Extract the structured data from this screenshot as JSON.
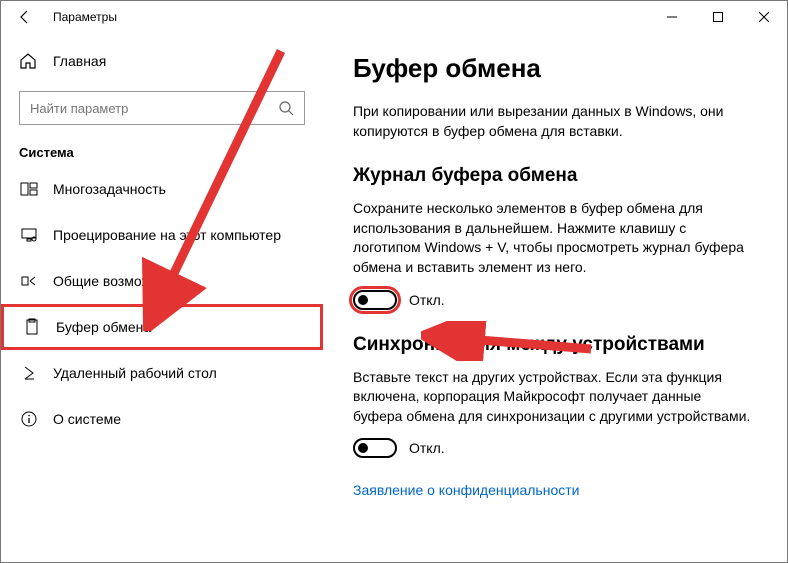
{
  "window": {
    "title": "Параметры"
  },
  "sidebar": {
    "home": "Главная",
    "search_placeholder": "Найти параметр",
    "group": "Система",
    "items": [
      {
        "label": "Многозадачность"
      },
      {
        "label": "Проецирование на этот компьютер"
      },
      {
        "label": "Общие возможности"
      },
      {
        "label": "Буфер обмена"
      },
      {
        "label": "Удаленный рабочий стол"
      },
      {
        "label": "О системе"
      }
    ]
  },
  "content": {
    "title": "Буфер обмена",
    "intro": "При копировании или вырезании данных в Windows, они копируются в буфер обмена для вставки.",
    "section1": {
      "title": "Журнал буфера обмена",
      "desc": "Сохраните несколько элементов в буфер обмена для использования в дальнейшем. Нажмите клавишу с логотипом Windows + V, чтобы просмотреть журнал буфера обмена и вставить элемент из него.",
      "toggle_label": "Откл."
    },
    "section2": {
      "title": "Синхронизация между устройствами",
      "desc": "Вставьте текст на других устройствах. Если эта функция включена, корпорация Майкрософт получает данные буфера обмена для синхронизации с другими устройствами.",
      "toggle_label": "Откл."
    },
    "privacy_link": "Заявление о конфиденциальности"
  }
}
